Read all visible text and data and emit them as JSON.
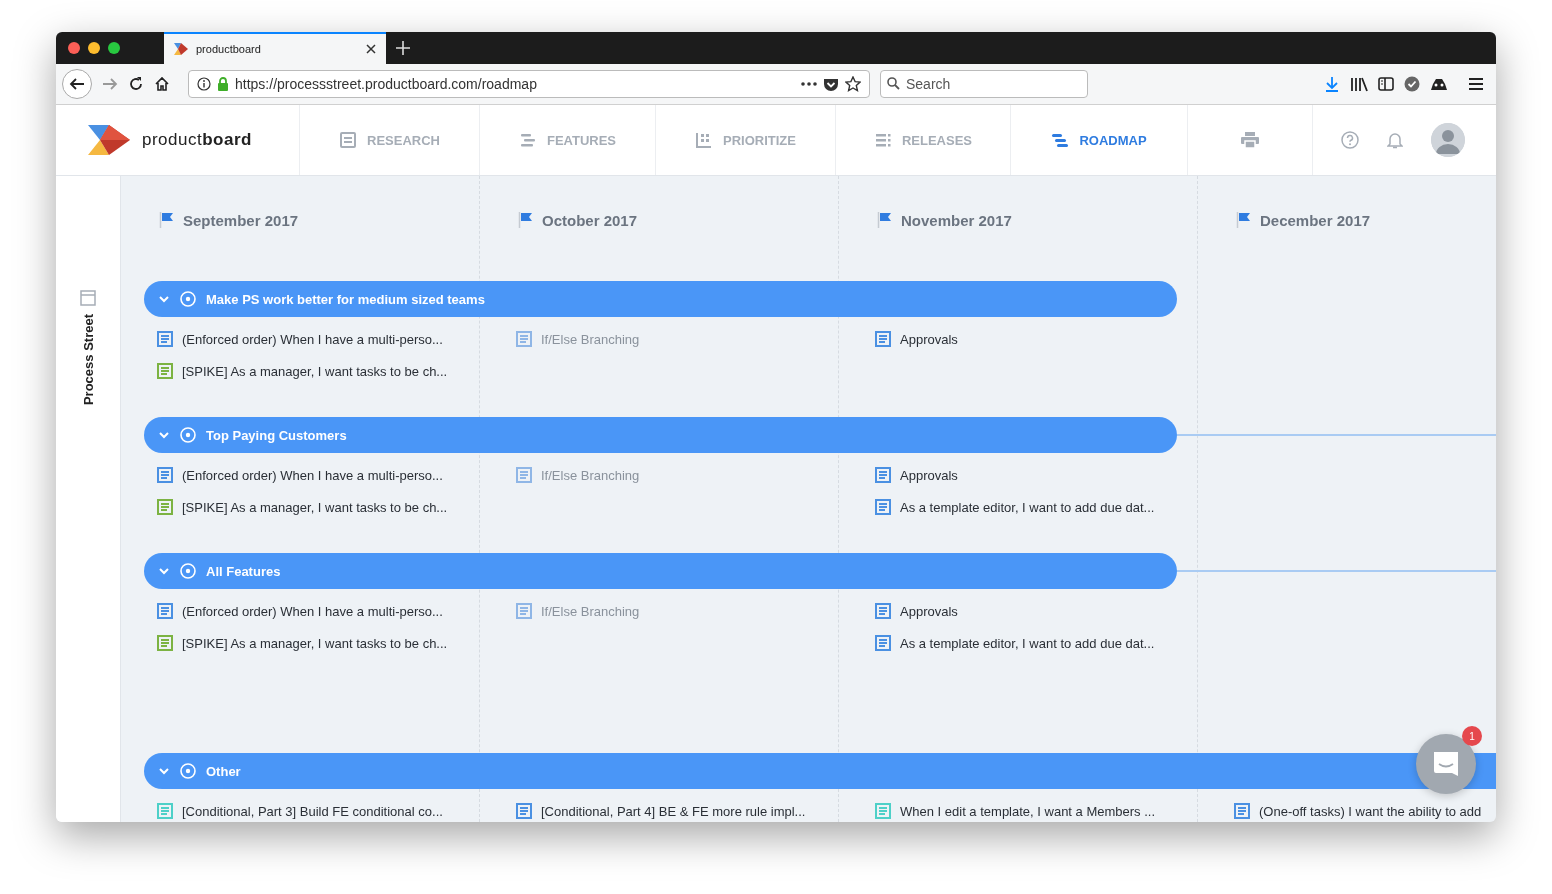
{
  "browser": {
    "tab_title": "productboard",
    "url": "https://processstreet.productboard.com/roadmap",
    "search_placeholder": "Search"
  },
  "app": {
    "logo": "product**board**",
    "nav": [
      {
        "label": "RESEARCH",
        "selected": false
      },
      {
        "label": "FEATURES",
        "selected": false
      },
      {
        "label": "PRIORITIZE",
        "selected": false
      },
      {
        "label": "RELEASES",
        "selected": false
      },
      {
        "label": "ROADMAP",
        "selected": true
      }
    ]
  },
  "sidebar": {
    "workspace": "Process Street"
  },
  "roadmap": {
    "months": [
      "September 2017",
      "October 2017",
      "November 2017",
      "December 2017"
    ],
    "groups": [
      {
        "title": "Make PS work better for medium sized teams",
        "expanded": true,
        "kind": "closed",
        "columns": [
          [
            {
              "text": "(Enforced order) When I have a multi-perso...",
              "color": "#4a90e2",
              "disabled": false
            },
            {
              "text": "[SPIKE] As a manager, I want tasks to be ch...",
              "color": "#7cb342",
              "disabled": false
            }
          ],
          [
            {
              "text": "If/Else Branching",
              "color": "#8fb6e6",
              "disabled": true
            }
          ],
          [
            {
              "text": "Approvals",
              "color": "#4a90e2",
              "disabled": false
            }
          ],
          []
        ]
      },
      {
        "title": "Top Paying Customers",
        "expanded": true,
        "kind": "linked",
        "columns": [
          [
            {
              "text": "(Enforced order) When I have a multi-perso...",
              "color": "#4a90e2",
              "disabled": false
            },
            {
              "text": "[SPIKE] As a manager, I want tasks to be ch...",
              "color": "#7cb342",
              "disabled": false
            }
          ],
          [
            {
              "text": "If/Else Branching",
              "color": "#8fb6e6",
              "disabled": true
            }
          ],
          [
            {
              "text": "Approvals",
              "color": "#4a90e2",
              "disabled": false
            },
            {
              "text": "As a template editor, I want to add due dat...",
              "color": "#4a90e2",
              "disabled": false
            }
          ],
          []
        ]
      },
      {
        "title": "All Features",
        "expanded": true,
        "kind": "linked",
        "columns": [
          [
            {
              "text": "(Enforced order) When I have a multi-perso...",
              "color": "#4a90e2",
              "disabled": false
            },
            {
              "text": "[SPIKE] As a manager, I want tasks to be ch...",
              "color": "#7cb342",
              "disabled": false
            }
          ],
          [
            {
              "text": "If/Else Branching",
              "color": "#8fb6e6",
              "disabled": true
            }
          ],
          [
            {
              "text": "Approvals",
              "color": "#4a90e2",
              "disabled": false
            },
            {
              "text": "As a template editor, I want to add due dat...",
              "color": "#4a90e2",
              "disabled": false
            }
          ],
          []
        ]
      },
      {
        "title": "Other",
        "expanded": true,
        "kind": "open",
        "columns": [
          [
            {
              "text": "[Conditional, Part 3] Build FE conditional co...",
              "color": "#4dd0c8",
              "disabled": false
            }
          ],
          [
            {
              "text": "[Conditional, Part 4] BE & FE more rule impl...",
              "color": "#4a90e2",
              "disabled": false
            }
          ],
          [
            {
              "text": "When I edit a template, I want a Members ...",
              "color": "#4dd0c8",
              "disabled": false
            }
          ],
          [
            {
              "text": "(One-off tasks) I want the ability to add",
              "color": "#4a90e2",
              "disabled": false
            }
          ]
        ]
      }
    ]
  },
  "chat": {
    "badge": "1"
  }
}
